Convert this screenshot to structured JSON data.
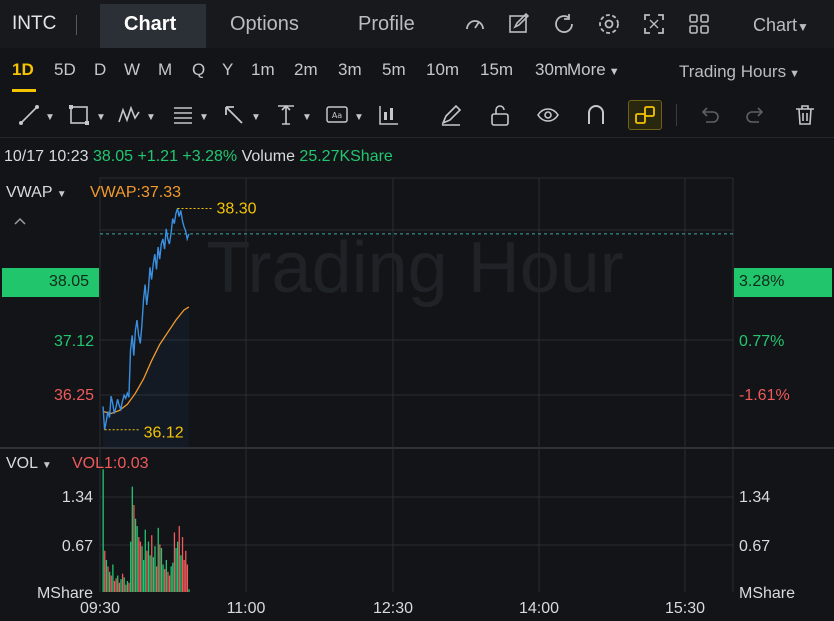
{
  "header": {
    "ticker": "INTC",
    "tabs": [
      {
        "label": "Chart",
        "active": true
      },
      {
        "label": "Options",
        "active": false
      },
      {
        "label": "Profile",
        "active": false
      }
    ],
    "chart_menu": "Chart",
    "icons": [
      "speedometer-icon",
      "edit-icon",
      "refresh-icon",
      "settings-icon",
      "fullscreen-icon",
      "grid-layout-icon"
    ]
  },
  "periods": {
    "items": [
      "1D",
      "5D",
      "D",
      "W",
      "M",
      "Q",
      "Y",
      "1m",
      "2m",
      "3m",
      "5m",
      "10m",
      "15m",
      "30m"
    ],
    "selected": "1D",
    "more": "More",
    "session": "Trading Hours"
  },
  "toolbar": {
    "icons": [
      "trendline-icon",
      "rectangle-icon",
      "pattern-icon",
      "fibonacci-icon",
      "arrow-icon",
      "measure-icon",
      "text-annotation-icon",
      "indicator-icon",
      "pencil-icon",
      "unlock-icon",
      "eye-icon",
      "magnet-icon",
      "link-icon",
      "undo-icon",
      "redo-icon",
      "trash-icon"
    ]
  },
  "quote": {
    "datetime": "10/17 10:23",
    "price": "38.05",
    "change": "+1.21",
    "change_pct": "+3.28%",
    "volume_label": "Volume",
    "volume": "25.27KShare"
  },
  "colors": {
    "up": "#22c670",
    "down": "#f05a5a",
    "price_line": "#3b8fe0",
    "vwap_line": "#f29a2a",
    "accent": "#f5c400"
  },
  "watermark": "Trading Hour",
  "chart_data": [
    {
      "type": "line",
      "indicator_label": "VWAP",
      "indicator_value": "VWAP:37.33",
      "y_ticks_left": [
        "38.05",
        "37.12",
        "36.25"
      ],
      "y_ticks_right": [
        "3.28%",
        "0.77%",
        "-1.61%"
      ],
      "current_price_badge": "38.05",
      "current_pct_badge": "3.28%",
      "high_label": "38.30",
      "low_label": "36.12",
      "x_ticks": [
        "09:30",
        "11:00",
        "12:30",
        "14:00",
        "15:30"
      ],
      "ylim": [
        35.95,
        38.6
      ],
      "series": [
        {
          "name": "price",
          "x": [
            0,
            1,
            2,
            3,
            4,
            5,
            6,
            7,
            8,
            9,
            10,
            11,
            12,
            13,
            14,
            15,
            16,
            17,
            18,
            19,
            20,
            21,
            22,
            23,
            24,
            25,
            26,
            27,
            28,
            29,
            30,
            31,
            32,
            33,
            34,
            35,
            36,
            37,
            38,
            39,
            40,
            41,
            42,
            43,
            44,
            45,
            46,
            47,
            48,
            49,
            50,
            51,
            52,
            53
          ],
          "values": [
            36.35,
            36.12,
            36.2,
            36.3,
            36.24,
            36.45,
            36.38,
            36.28,
            36.34,
            36.42,
            36.36,
            36.32,
            36.4,
            36.46,
            36.43,
            36.48,
            36.44,
            36.9,
            37.05,
            36.85,
            37.1,
            37.2,
            37.05,
            36.97,
            37.15,
            37.4,
            37.55,
            37.35,
            37.5,
            37.72,
            37.6,
            37.75,
            37.85,
            37.7,
            37.92,
            37.8,
            37.95,
            38.0,
            37.9,
            38.1,
            38.0,
            37.95,
            38.05,
            38.2,
            38.15,
            38.25,
            38.3,
            38.22,
            38.28,
            38.18,
            38.12,
            38.08,
            38.0,
            38.05
          ]
        },
        {
          "name": "VWAP",
          "x": [
            0,
            5,
            10,
            15,
            20,
            25,
            30,
            35,
            40,
            45,
            50,
            53
          ],
          "values": [
            36.3,
            36.28,
            36.31,
            36.37,
            36.48,
            36.62,
            36.8,
            36.96,
            37.08,
            37.2,
            37.3,
            37.33
          ]
        }
      ]
    },
    {
      "type": "bar",
      "indicator_label": "VOL",
      "indicator_value": "VOL1:0.03",
      "y_ticks": [
        "1.34",
        "0.67"
      ],
      "unit": "MShare",
      "ylim": [
        0,
        1.55
      ],
      "values": [
        1.34,
        0.45,
        0.35,
        0.28,
        0.22,
        0.18,
        0.3,
        0.12,
        0.15,
        0.18,
        0.1,
        0.14,
        0.2,
        0.16,
        0.08,
        0.12,
        0.1,
        0.55,
        1.15,
        0.95,
        0.8,
        0.72,
        0.6,
        0.55,
        0.5,
        0.35,
        0.68,
        0.45,
        0.55,
        0.4,
        0.62,
        0.38,
        0.5,
        0.28,
        0.7,
        0.52,
        0.48,
        0.3,
        0.25,
        0.35,
        0.22,
        0.18,
        0.28,
        0.32,
        0.65,
        0.48,
        0.55,
        0.72,
        0.4,
        0.6,
        0.35,
        0.45,
        0.3,
        0.03
      ],
      "up": [
        1,
        0,
        1,
        0,
        1,
        0,
        1,
        0,
        0,
        1,
        0,
        1,
        0,
        1,
        0,
        1,
        0,
        1,
        1,
        0,
        1,
        1,
        0,
        0,
        1,
        1,
        1,
        0,
        1,
        1,
        0,
        1,
        1,
        0,
        1,
        0,
        1,
        1,
        0,
        1,
        0,
        0,
        1,
        1,
        0,
        1,
        1,
        0,
        1,
        0,
        0,
        0,
        0,
        1
      ]
    }
  ]
}
